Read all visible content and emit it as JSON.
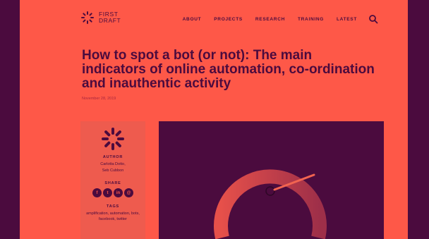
{
  "brand": {
    "line1": "FIRST",
    "line2": "DRAFT"
  },
  "nav": [
    "ABOUT",
    "PROJECTS",
    "RESEARCH",
    "TRAINING",
    "LATEST"
  ],
  "article": {
    "title": "How to spot a bot (or not): The main indicators of online automation, co-ordination and inauthentic activity",
    "date": "November 28, 2019"
  },
  "sidebar": {
    "author_label": "AUTHOR",
    "author_names": [
      "Carlotta Dotto,",
      "Seb Cubbon"
    ],
    "share_label": "SHARE",
    "tags_label": "TAGS",
    "tags": "amplification, automation, bots, facebook, twitter"
  },
  "colors": {
    "background": "#4b0b3e",
    "accent": "#fe5848"
  },
  "icons": [
    "logo-icon",
    "search-icon",
    "speedometer-illustration"
  ]
}
